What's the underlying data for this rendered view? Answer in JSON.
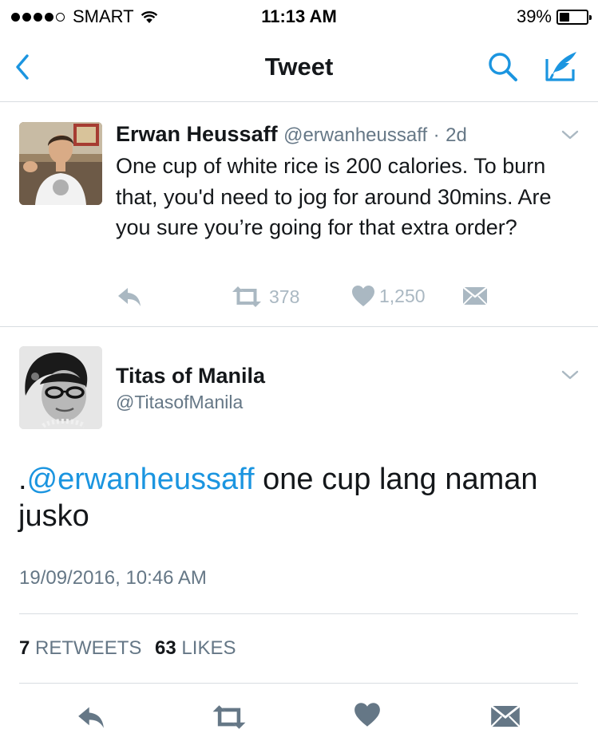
{
  "status_bar": {
    "carrier": "SMART",
    "time": "11:13 AM",
    "battery_text": "39%",
    "battery_level": 0.39,
    "signal_bars": 4
  },
  "nav": {
    "title": "Tweet",
    "back_icon": "back-chevron-icon",
    "search_icon": "search-icon",
    "compose_icon": "compose-tweet-icon",
    "accent_color": "#1b95e0"
  },
  "tweet1": {
    "name": "Erwan Heussaff",
    "handle": "@erwanheussaff",
    "time_sep": "·",
    "time": "2d",
    "text": "One cup of white rice is 200 calories. To burn that, you'd need to jog for around 30mins. Are you sure you’re going for that extra order?",
    "retweets": "378",
    "likes": "1,250"
  },
  "tweet2": {
    "name": "Titas of Manila",
    "handle": "@TitasofManila",
    "text_prefix": ".",
    "mention": "@erwanheussaff",
    "text_rest": " one cup lang naman jusko",
    "date": "19/09/2016, 10:46 AM",
    "retweets_count": "7",
    "retweets_label": "RETWEETS",
    "likes_count": "63",
    "likes_label": "LIKES"
  }
}
